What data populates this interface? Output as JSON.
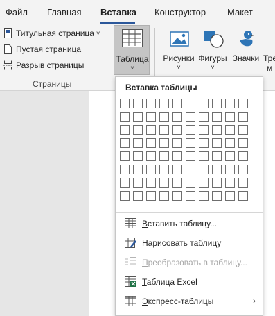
{
  "tabs": [
    {
      "label": "Файл",
      "active": false
    },
    {
      "label": "Главная",
      "active": false
    },
    {
      "label": "Вставка",
      "active": true
    },
    {
      "label": "Конструктор",
      "active": false
    },
    {
      "label": "Макет",
      "active": false
    }
  ],
  "pages_group": {
    "items": [
      {
        "label": "Титульная страница",
        "has_caret": true
      },
      {
        "label": "Пустая страница",
        "has_caret": false
      },
      {
        "label": "Разрыв страницы",
        "has_caret": false
      }
    ],
    "caret": "˅",
    "group_label": "Страницы"
  },
  "ribbon_buttons": {
    "table": {
      "label": "Таблица",
      "caret": "˅"
    },
    "pictures": {
      "label": "Рисунки",
      "caret": "˅"
    },
    "shapes": {
      "label": "Фигуры",
      "caret": "˅"
    },
    "icons": {
      "label": "Значки"
    },
    "more_line1": "Тре",
    "more_line2": "м"
  },
  "insert_table_menu": {
    "title": "Вставка таблицы",
    "grid_columns": 10,
    "grid_rows": 8,
    "items": [
      {
        "label": "Вставить таблицу...",
        "underline_char": "В",
        "rest": "ставить таблицу...",
        "icon": "insert-table-icon",
        "disabled": false,
        "submenu": false
      },
      {
        "label": "Нарисовать таблицу",
        "underline_char": "Н",
        "rest": "арисовать таблицу",
        "icon": "draw-table-icon",
        "disabled": false,
        "submenu": false
      },
      {
        "label": "Преобразовать в таблицу...",
        "underline_char": "П",
        "rest": "реобразовать в таблицу...",
        "icon": "convert-to-table-icon",
        "disabled": true,
        "submenu": false
      },
      {
        "label": "Таблица Excel",
        "underline_char": "Т",
        "rest": "аблица Excel",
        "icon": "excel-table-icon",
        "disabled": false,
        "submenu": false
      },
      {
        "label": "Экспресс-таблицы",
        "underline_char": "Э",
        "rest": "кспресс-таблицы",
        "icon": "quick-tables-icon",
        "disabled": false,
        "submenu": true
      }
    ],
    "submenu_arrow": "›"
  },
  "colors": {
    "accent": "#2b579a",
    "excel_green": "#217346",
    "shapes_blue": "#2e75b6"
  }
}
